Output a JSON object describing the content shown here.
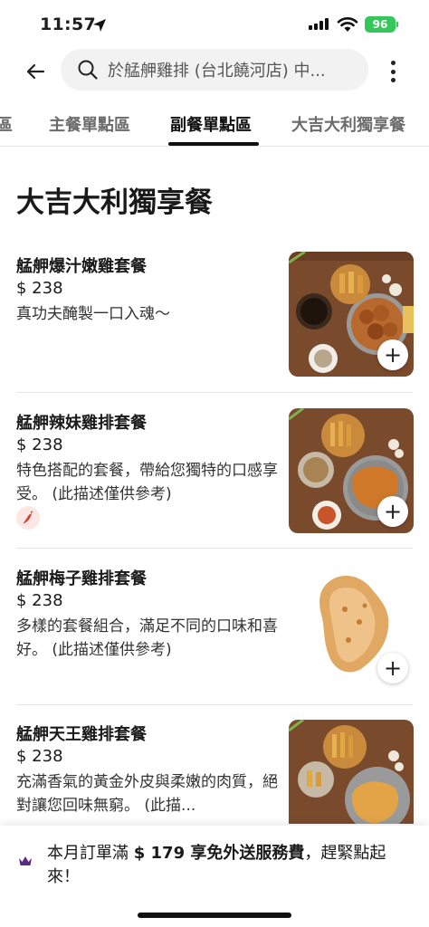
{
  "status": {
    "time": "11:57",
    "battery": "96"
  },
  "search": {
    "text": "於艋舺雞排 (台北饒河店) 中..."
  },
  "tabs": [
    {
      "label": "區"
    },
    {
      "label": "主餐單點區"
    },
    {
      "label": "副餐單點區"
    },
    {
      "label": "大吉大利獨享餐"
    }
  ],
  "section": {
    "title": "大吉大利獨享餐"
  },
  "items": [
    {
      "name": "艋舺爆汁嫩雞套餐",
      "price": "$ 238",
      "desc": "真功夫醃製一口入魂～",
      "add": "+"
    },
    {
      "name": "艋舺辣妹雞排套餐",
      "price": "$ 238",
      "desc": "特色搭配的套餐，帶給您獨特的口感享受。 (此描述僅供參考)",
      "add": "+",
      "tag_icon": "chili-pepper-icon"
    },
    {
      "name": "艋舺梅子雞排套餐",
      "price": "$ 238",
      "desc": "多樣的套餐組合，滿足不同的口味和喜好。 (此描述僅供參考)",
      "add": "+"
    },
    {
      "name": "艋舺天王雞排套餐",
      "price": "$ 238",
      "desc": "充滿香氣的黃金外皮與柔嫩的肉質，絕對讓您回味無窮。 (此描...",
      "add": "+"
    }
  ],
  "banner": {
    "prefix": "本月訂單滿 ",
    "amount": "$ 179",
    "bold": " 享免外送服務費",
    "suffix": "，趕緊點起來！"
  },
  "colors": {
    "accent": "#111111",
    "crown": "#5b2a86",
    "chili": "#d63b2a",
    "battery": "#35c759"
  }
}
